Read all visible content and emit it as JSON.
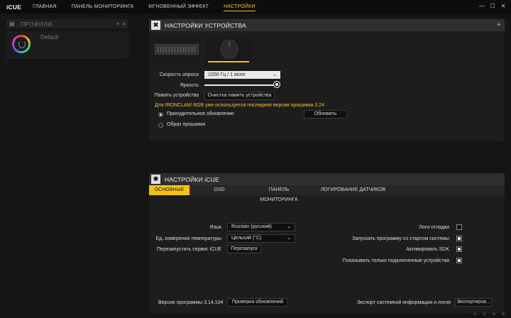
{
  "app": {
    "logo": "iCUE",
    "nav": [
      "ГЛАВНАЯ",
      "ПАНЕЛЬ МОНИТОРИНГА",
      "МГНОВЕННЫЙ ЭФФЕКТ",
      "НАСТРОЙКИ"
    ],
    "active_nav": "НАСТРОЙКИ",
    "window_controls": [
      "minimize-icon",
      "maximize-icon",
      "close-icon"
    ]
  },
  "sidebar": {
    "title": "ПРОФИЛИ",
    "add_symbol": "+",
    "menu_symbol": "≡",
    "profile": {
      "name": "Default"
    }
  },
  "device_settings": {
    "title": "НАСТРОЙКИ УСТРОЙСТВА",
    "devices": [
      {
        "name": "keyboard",
        "active": false
      },
      {
        "name": "mouse",
        "active": true
      }
    ],
    "polling_label": "Скорость опроса",
    "polling_value": "1000 Гц / 1 мсек",
    "brightness_label": "Яркость",
    "brightness_level": 1.0,
    "memory_label": "Память устройства",
    "memory_button": "Очистка память устройства",
    "firmware_note": "Для IRONCLAW RGB уже используется последняя версия прошивки 3.24",
    "force_update_label": "Принудительное обновление",
    "update_button": "Обновить",
    "firmware_image_label": "Образ прошивки"
  },
  "icue_settings": {
    "title": "НАСТРОЙКИ iCUE",
    "tabs": [
      "ОСНОВНЫЕ",
      "OSD",
      "ПАНЕЛЬ МОНИТОРИНГА",
      "ЛОГИРОВАНИЕ ДАТЧИКОВ"
    ],
    "active_tab": "ОСНОВНЫЕ",
    "language_label": "Язык",
    "language_value": "Russian (русский)",
    "temp_label": "Ед. измерения температуры",
    "temp_value": "Цельсий (°C)",
    "restart_label": "Перезапустить сервис iCUE",
    "restart_button": "Перезапуск",
    "debug_logs_label": "Логи отладки",
    "debug_logs_checked": false,
    "startup_label": "Запускать программу со стартом системы",
    "startup_checked": true,
    "sdk_label": "Активировать SDK",
    "sdk_checked": true,
    "connected_only_label": "Показывать только подключенные устройства",
    "connected_only_checked": true,
    "version_label": "Версия программы 3.14.104",
    "check_updates_button": "Проверка обновлений",
    "export_label": "Экспорт системной информации и логов",
    "export_button": "Экспортиров..."
  },
  "colors": {
    "accent": "#f2c30e",
    "background": "#151515",
    "panel": "#1d1d1d"
  }
}
